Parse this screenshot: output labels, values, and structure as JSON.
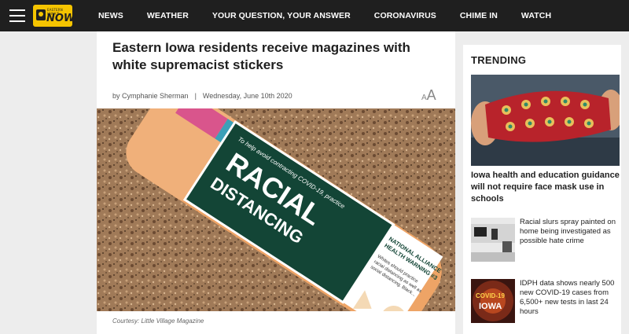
{
  "header": {
    "logo_small": "EASTERN IOWA'S",
    "logo_main": "NOW",
    "nav": [
      "NEWS",
      "WEATHER",
      "YOUR QUESTION, YOUR ANSWER",
      "CORONAVIRUS",
      "CHIME IN",
      "WATCH"
    ]
  },
  "article": {
    "headline": "Eastern Iowa residents receive magazines with white supremacist stickers",
    "author": "by Cymphanie Sherman",
    "separator": "|",
    "date": "Wednesday, June 10th 2020",
    "font_small": "A",
    "font_big": "A",
    "photo": {
      "sticker_line1": "To help avoid contracting COVID-19, practice",
      "sticker_big1": "RACIAL",
      "sticker_big2": "DISTANCING",
      "sticker_side1": "NATIONAL ALLIANCE",
      "sticker_side2": "HEALTH WARNING #3",
      "sticker_side3": "Whites should practice",
      "sticker_side4": "racial distancing as well as",
      "sticker_side5": "social distancing. Black..."
    },
    "caption": "Courtesy: Little Village Magazine"
  },
  "trending": {
    "title": "TRENDING",
    "featured_title": "Iowa health and education guidance will not require face mask use in schools",
    "items": [
      {
        "title": "Racial slurs spray painted on home being investigated as possible hate crime"
      },
      {
        "title": "IDPH data shows nearly 500 new COVID-19 cases from 6,500+ new tests in last 24 hours",
        "thumb_text1": "COVID-19",
        "thumb_text2": "IOWA"
      }
    ]
  },
  "colors": {
    "topbar": "#1f1f1f",
    "logo": "#f5c400",
    "page_bg": "#ededed"
  }
}
